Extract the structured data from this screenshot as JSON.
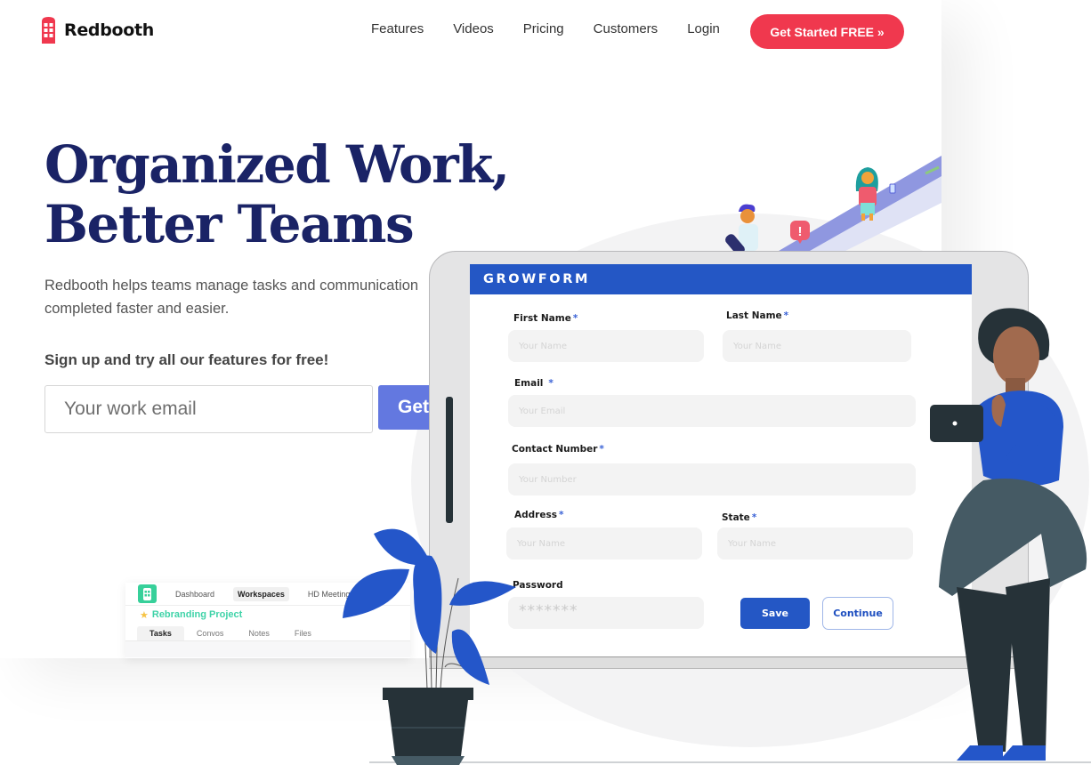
{
  "brand": {
    "name": "Redbooth",
    "accent_color": "#f0384e",
    "logo_icon": "phone-booth-icon"
  },
  "nav": {
    "items": [
      "Features",
      "Videos",
      "Pricing",
      "Customers",
      "Login"
    ],
    "cta_label": "Get Started FREE »"
  },
  "hero": {
    "title_line1": "Organized Work,",
    "title_line2": "Better Teams",
    "subtitle": "Redbooth helps teams manage tasks and communication completed faster and easier.",
    "signup_label": "Sign up and try all our features for free!",
    "email_placeholder": "Your work email",
    "get_button_label": "Get",
    "title_color": "#1a2366",
    "button_color": "#6378e0"
  },
  "mini_app": {
    "nav": [
      "Dashboard",
      "Workspaces",
      "HD Meetings"
    ],
    "active_nav": "Workspaces",
    "project_name": "Rebranding Project",
    "tabs": [
      "Tasks",
      "Convos",
      "Notes",
      "Files"
    ],
    "active_tab": "Tasks"
  },
  "illustration": {
    "alert_badge": "!"
  },
  "form": {
    "title": "GROWFORM",
    "header_color": "#2457c5",
    "required_marker": "*",
    "fields": {
      "first_name": {
        "label": "First Name",
        "placeholder": "Your Name",
        "required": true
      },
      "last_name": {
        "label": "Last Name",
        "placeholder": "Your Name",
        "required": true
      },
      "email": {
        "label": "Email",
        "placeholder": "Your Email",
        "required": true
      },
      "contact": {
        "label": "Contact Number",
        "placeholder": "Your Number",
        "required": true
      },
      "address": {
        "label": "Address",
        "placeholder": "Your Name",
        "required": true
      },
      "state": {
        "label": "State",
        "placeholder": "Your Name",
        "required": true
      },
      "password": {
        "label": "Password",
        "placeholder": "*******",
        "required": false
      }
    },
    "save_label": "Save",
    "continue_label": "Continue"
  }
}
